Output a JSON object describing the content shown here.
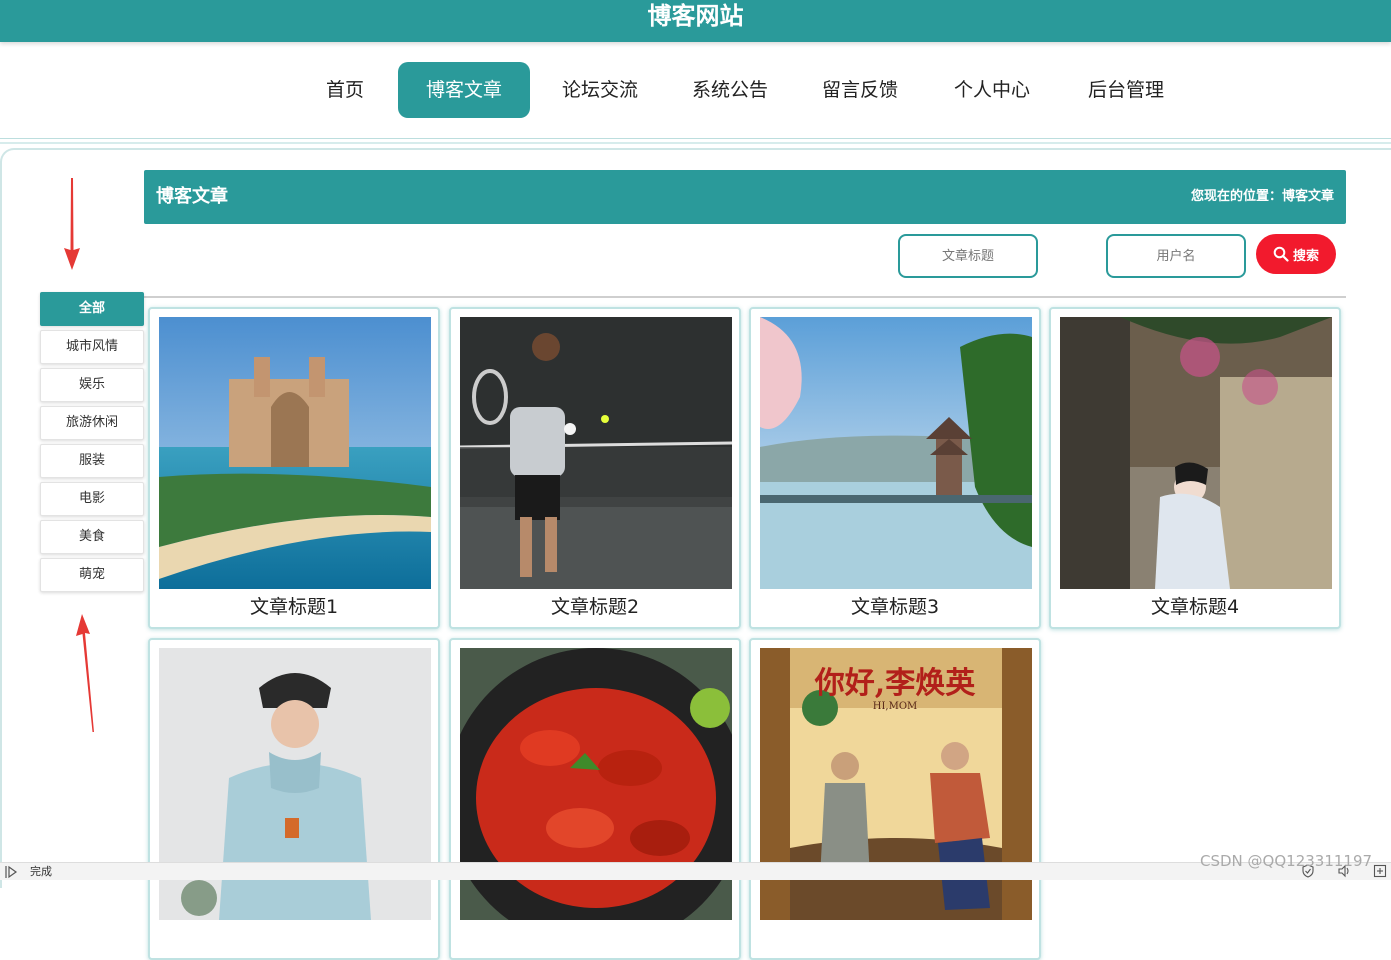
{
  "header": {
    "site_title": "博客网站"
  },
  "nav": {
    "items": [
      {
        "label": "首页",
        "active": false
      },
      {
        "label": "博客文章",
        "active": true
      },
      {
        "label": "论坛交流",
        "active": false
      },
      {
        "label": "系统公告",
        "active": false
      },
      {
        "label": "留言反馈",
        "active": false
      },
      {
        "label": "个人中心",
        "active": false
      },
      {
        "label": "后台管理",
        "active": false
      }
    ]
  },
  "section": {
    "title": "博客文章",
    "location": "您现在的位置：博客文章"
  },
  "search": {
    "title_placeholder": "文章标题",
    "username_placeholder": "用户名",
    "button_label": "搜索"
  },
  "categories": [
    {
      "label": "全部",
      "active": true
    },
    {
      "label": "城市风情",
      "active": false
    },
    {
      "label": "娱乐",
      "active": false
    },
    {
      "label": "旅游休闲",
      "active": false
    },
    {
      "label": "服装",
      "active": false
    },
    {
      "label": "电影",
      "active": false
    },
    {
      "label": "美食",
      "active": false
    },
    {
      "label": "萌宠",
      "active": false
    }
  ],
  "articles": [
    {
      "title": "文章标题1",
      "image": "resort-hotel-beach"
    },
    {
      "title": "文章标题2",
      "image": "tennis-player"
    },
    {
      "title": "文章标题3",
      "image": "lake-pavilion"
    },
    {
      "title": "文章标题4",
      "image": "woman-by-canal"
    },
    {
      "title": "",
      "image": "woman-in-hoodie"
    },
    {
      "title": "",
      "image": "crayfish-dish"
    },
    {
      "title": "",
      "image": "movie-poster",
      "poster_title": "你好,李焕英",
      "poster_subtitle": "HI,MOM"
    }
  ],
  "status": {
    "text": "完成"
  },
  "watermark": "CSDN @QQ123311197",
  "colors": {
    "accent": "#2a9a9a",
    "search_button": "#f21a2d",
    "arrow": "#e53935"
  }
}
